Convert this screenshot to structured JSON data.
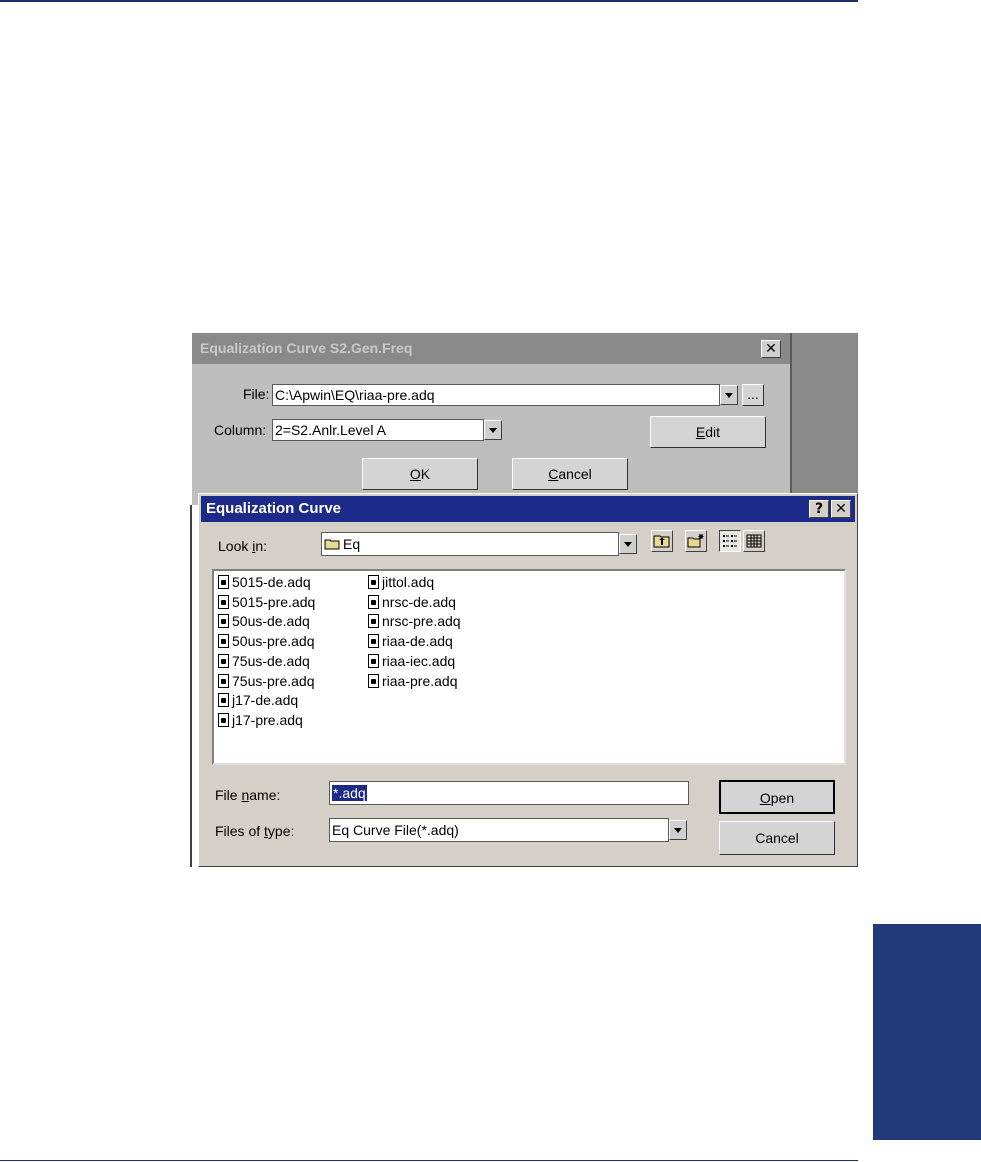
{
  "back_dialog": {
    "title": "Equalization Curve S2.Gen.Freq",
    "close_glyph": "✕",
    "file_label": "File:",
    "file_value": "C:\\Apwin\\EQ\\riaa-pre.adq",
    "browse_label": "...",
    "column_label": "Column:",
    "column_value": "2=S2.Anlr.Level A",
    "edit_label_u": "E",
    "edit_label_rest": "dit",
    "ok_label_u": "O",
    "ok_label_rest": "K",
    "cancel_label_u": "C",
    "cancel_label_rest": "ancel"
  },
  "open_dialog": {
    "title": "Equalization Curve",
    "help_glyph": "?",
    "close_glyph": "✕",
    "look_in_label_pre": "Look ",
    "look_in_label_u": "i",
    "look_in_label_post": "n:",
    "look_in_value": "Eq",
    "files_col1": [
      "5015-de.adq",
      "5015-pre.adq",
      "50us-de.adq",
      "50us-pre.adq",
      "75us-de.adq",
      "75us-pre.adq",
      "j17-de.adq",
      "j17-pre.adq"
    ],
    "files_col2": [
      "jittol.adq",
      "nrsc-de.adq",
      "nrsc-pre.adq",
      "riaa-de.adq",
      "riaa-iec.adq",
      "riaa-pre.adq"
    ],
    "file_name_label_pre": "File ",
    "file_name_label_u": "n",
    "file_name_label_post": "ame:",
    "file_name_value": "*.adq",
    "files_of_type_label_pre": "Files of ",
    "files_of_type_label_u": "t",
    "files_of_type_label_post": "ype:",
    "files_of_type_value": "Eq Curve File(*.adq)",
    "open_label_u": "O",
    "open_label_rest": "pen",
    "cancel_label": "Cancel"
  },
  "colors": {
    "title_bar": "#1c2a8a",
    "side_tab": "#233a7a",
    "dialog_face": "#d4d0c8"
  }
}
